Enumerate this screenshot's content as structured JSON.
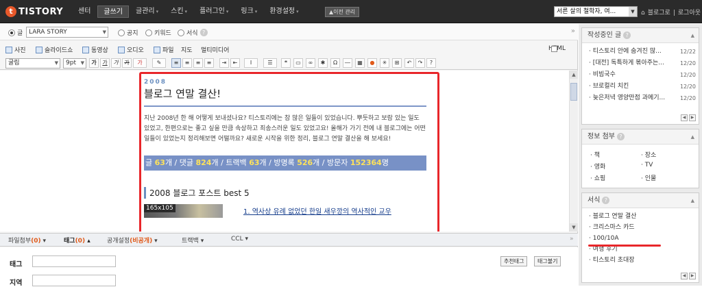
{
  "topnav": {
    "logo_letter": "t",
    "logo_text": "TISTORY",
    "menu": [
      {
        "label": "센터",
        "caret": false
      },
      {
        "label": "글쓰기",
        "caret": false,
        "active": true
      },
      {
        "label": "글관리",
        "caret": true
      },
      {
        "label": "스킨",
        "caret": true
      },
      {
        "label": "플러그인",
        "caret": true
      },
      {
        "label": "링크",
        "caret": true
      },
      {
        "label": "환경설정",
        "caret": true
      }
    ],
    "prev_admin": "▲이전 관리",
    "blog_select": "서른 살의 철학자, 여...",
    "blog_link": "블로그로",
    "logout": "로그아웃"
  },
  "editor": {
    "post_type": [
      {
        "label": "글",
        "checked": true
      },
      {
        "label": "공지",
        "checked": false
      },
      {
        "label": "키워드",
        "checked": false
      },
      {
        "label": "서식",
        "checked": false
      }
    ],
    "category_value": "LARA STORY",
    "insert_items": [
      "사진",
      "슬라이드쇼",
      "동영상",
      "오디오",
      "파일",
      "지도",
      "멀티미디어"
    ],
    "html_label": "HTML",
    "font_family": "굴림",
    "font_size": "9pt",
    "format_buttons": [
      "가",
      "가",
      "가",
      "가",
      "가"
    ]
  },
  "post": {
    "year": "2008",
    "title": "블로그 연말 결산!",
    "body": "지난 2008년 한 해 어떻게 보내셨나요? 티스토리에는 참 많은 일들이 있었습니다. 뿌듯하고 보람 있는 일도 있었고, 한편으로는 좋고 싶을 만큼 속상하고 죄송스러운 일도 있었고요! 올해가 가기 전에 내 블로그에는 어떤 일들이 있었는지 정리해보면 어떨까요? 새로운 시작을 위한 정리, 블로그 연말 결산을 해 보세요!",
    "stats": {
      "posts_label": "글",
      "posts": "63",
      "posts_unit": "개",
      "comments_label": "댓글",
      "comments": "824",
      "comments_unit": "개",
      "trackbacks_label": "트랙백",
      "trackbacks": "63",
      "trackbacks_unit": "개",
      "guestbook_label": "방명록",
      "guestbook": "526",
      "guestbook_unit": "개",
      "visitors_label": "방문자",
      "visitors": "152364",
      "visitors_unit": "명"
    },
    "best_heading": "2008 블로그 포스트 best 5",
    "thumb_label": "165x105",
    "best_item": "1. 역사상 유례 없었던 한일 새우깡의 역사적인 교우"
  },
  "bottom_tabs": {
    "file_label": "파일첨부",
    "file_count": "(0)",
    "tag_label": "태그",
    "tag_count": "(0)",
    "open_label": "공개설정",
    "open_value": "(비공개)",
    "trackback_label": "트랙백",
    "ccl_label": "CCL"
  },
  "bottom_panel": {
    "tag_field": "태그",
    "location_field": "지역",
    "recommend_tags": "추천태그",
    "tag_load": "태그불기"
  },
  "sidebar": {
    "drafts_title": "작성중인 글",
    "drafts": [
      {
        "title": "티스토리 안에 숨겨진 많...",
        "date": "12/22"
      },
      {
        "title": "[대전] 독특하게 볶아주는...",
        "date": "12/20"
      },
      {
        "title": "비빔국수",
        "date": "12/20"
      },
      {
        "title": "브로컬리 치킨",
        "date": "12/20"
      },
      {
        "title": "늦은저녁 영양만점 과메기...",
        "date": "12/20"
      }
    ],
    "info_title": "정보 첨부",
    "info_items": [
      "책",
      "장소",
      "영화",
      "TV",
      "쇼핑",
      "인물"
    ],
    "template_title": "서식",
    "templates": [
      "블로그 연말 결산",
      "크리스마스 카드",
      "100/10A",
      "여행 후기",
      "티스토리 초대장"
    ]
  },
  "colors": {
    "highlight_red": "#e8262a",
    "stats_bg": "#7891c6",
    "stats_number": "#ffe35a",
    "nav_bg": "#2b2b2b"
  }
}
